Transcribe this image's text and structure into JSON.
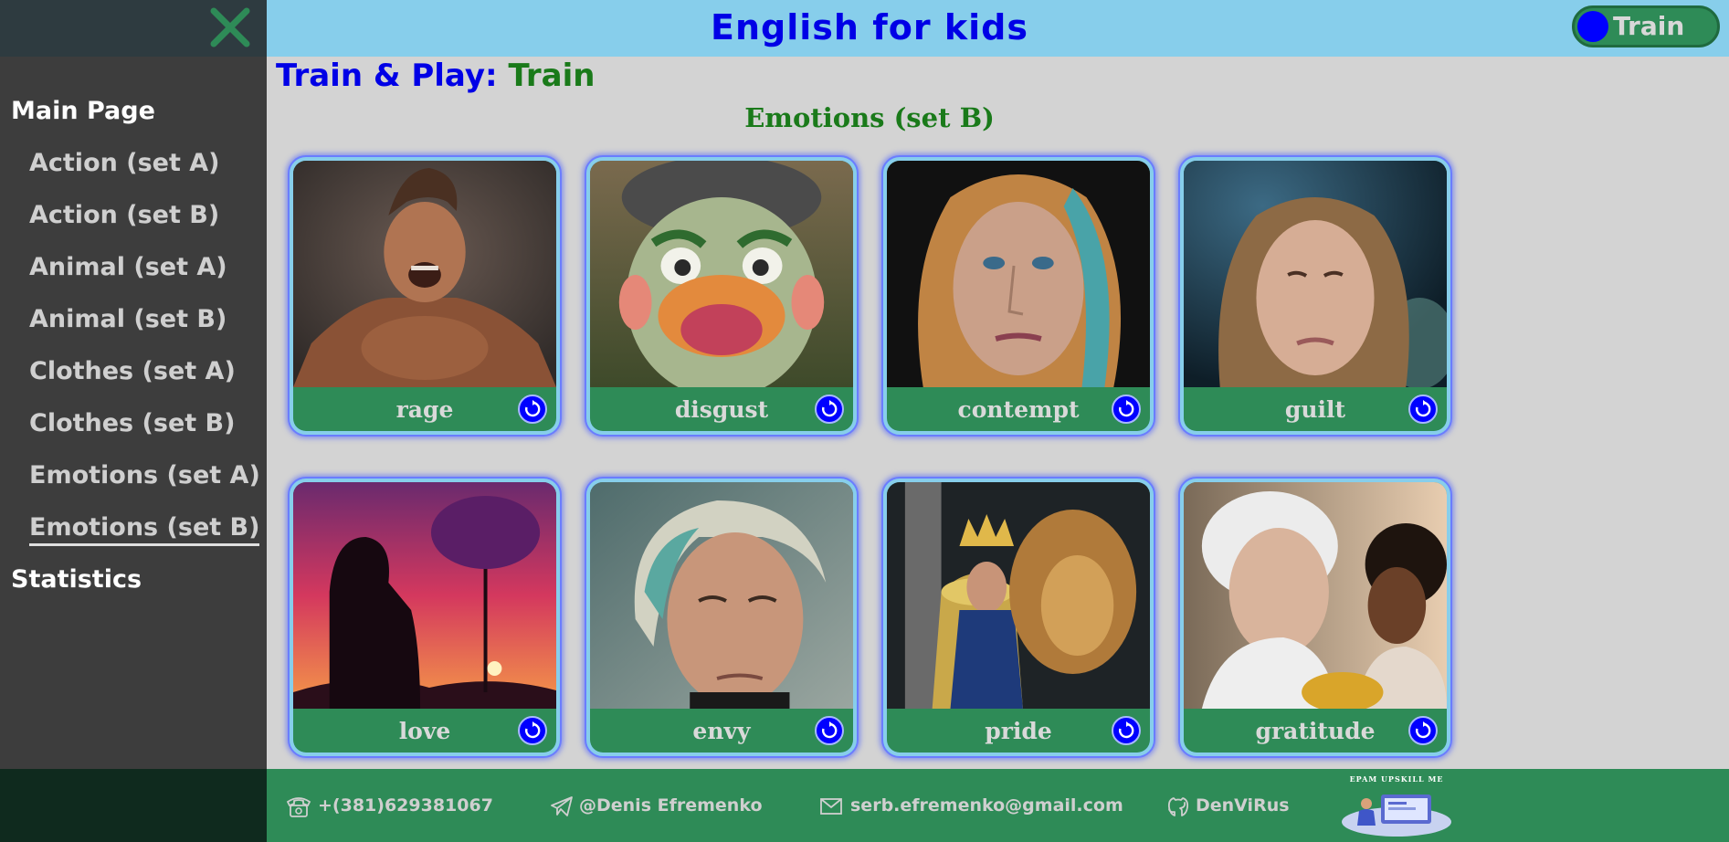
{
  "header": {
    "title": "English for kids",
    "mode_toggle_label": "Train"
  },
  "sidebar": {
    "items": [
      {
        "label": "Main Page",
        "level": "top"
      },
      {
        "label": "Action (set A)",
        "level": "sub"
      },
      {
        "label": "Action (set B)",
        "level": "sub"
      },
      {
        "label": "Animal (set A)",
        "level": "sub"
      },
      {
        "label": "Animal (set B)",
        "level": "sub"
      },
      {
        "label": "Clothes (set A)",
        "level": "sub"
      },
      {
        "label": "Clothes (set B)",
        "level": "sub"
      },
      {
        "label": "Emotions (set A)",
        "level": "sub"
      },
      {
        "label": "Emotions (set B)",
        "level": "sub",
        "active": true
      },
      {
        "label": "Statistics",
        "level": "top"
      }
    ]
  },
  "main": {
    "mode_prefix": "Train & Play:",
    "mode_value": "Train",
    "category_title": "Emotions (set B)",
    "cards": [
      {
        "word": "rage",
        "image": "muscular-man-shouting"
      },
      {
        "word": "disgust",
        "image": "cartoon-face-tongue-out"
      },
      {
        "word": "contempt",
        "image": "woman-stern-face"
      },
      {
        "word": "guilt",
        "image": "woman-sad-face"
      },
      {
        "word": "love",
        "image": "mother-child-sunset-silhouette"
      },
      {
        "word": "envy",
        "image": "young-man-portrait"
      },
      {
        "word": "pride",
        "image": "king-on-throne-with-lion"
      },
      {
        "word": "gratitude",
        "image": "grandmother-and-child"
      }
    ]
  },
  "footer": {
    "phone": "+(381)629381067",
    "telegram": "@Denis Efremenko",
    "email": "serb.efremenko@gmail.com",
    "github": "DenViRus",
    "logo_text": "EPAM UPSKILL ME"
  },
  "colors": {
    "header_bg": "#87ceeb",
    "sidebar_bg": "#3d3d3d",
    "accent_blue": "#0000e6",
    "accent_green": "#2e8b57",
    "title_green": "#1a7a1a",
    "page_bg": "#d3d3d3"
  }
}
